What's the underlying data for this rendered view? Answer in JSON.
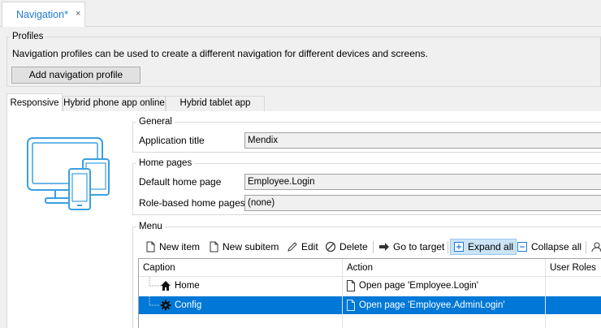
{
  "document_tab": {
    "title": "Navigation*",
    "close": "×"
  },
  "profiles": {
    "group_label": "Profiles",
    "description": "Navigation profiles can be used to create a different navigation for different devices and screens.",
    "add_button": "Add navigation profile"
  },
  "profile_tabs": [
    {
      "label": "Responsive"
    },
    {
      "label": "Hybrid phone app online"
    },
    {
      "label": "Hybrid tablet app online"
    }
  ],
  "general": {
    "group_label": "General",
    "app_title_label": "Application title",
    "app_title_value": "Mendix"
  },
  "home_pages": {
    "group_label": "Home pages",
    "default_label": "Default home page",
    "default_value": "Employee.Login",
    "role_label": "Role-based home pages",
    "role_value": "(none)"
  },
  "menu": {
    "group_label": "Menu",
    "toolbar": {
      "new_item": "New item",
      "new_subitem": "New subitem",
      "edit": "Edit",
      "delete": "Delete",
      "go_to_target": "Go to target",
      "expand_all": "Expand all",
      "collapse_all": "Collapse all"
    },
    "columns": {
      "caption": "Caption",
      "action": "Action",
      "roles": "User Roles"
    },
    "rows": [
      {
        "caption": "Home",
        "icon": "home-icon",
        "action": "Open page 'Employee.Login'",
        "selected": false
      },
      {
        "caption": "Config",
        "icon": "gear-icon",
        "action": "Open page 'Employee.AdminLogin'",
        "selected": true
      }
    ]
  },
  "colors": {
    "accent": "#1e7bd6",
    "selection": "#0078d7",
    "device_illustration": "#3aa0e0"
  }
}
